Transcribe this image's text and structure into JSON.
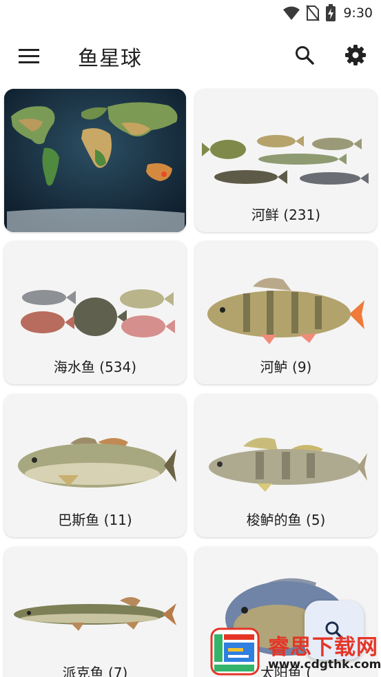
{
  "status_bar": {
    "time": "9:30"
  },
  "app_bar": {
    "title": "鱼星球"
  },
  "categories": [
    {
      "label": "",
      "image": "world-map"
    },
    {
      "label": "河鲜 (231)",
      "image": "freshwater-fish-group"
    },
    {
      "label": "海水鱼 (534)",
      "image": "saltwater-fish-group"
    },
    {
      "label": "河鲈 (9)",
      "image": "perch"
    },
    {
      "label": "巴斯鱼 (11)",
      "image": "bass"
    },
    {
      "label": "梭鲈的鱼 (5)",
      "image": "zander"
    },
    {
      "label": "派克鱼 (7)",
      "image": "pike"
    },
    {
      "label": "太阳鱼 (",
      "image": "sunfish"
    }
  ],
  "watermark": {
    "title": "睿思下载网",
    "url": "www.cdgthk.com"
  },
  "colors": {
    "accent": "#e53527",
    "fab_bg": "#e6ecf8",
    "card_bg": "#f5f4f4"
  }
}
